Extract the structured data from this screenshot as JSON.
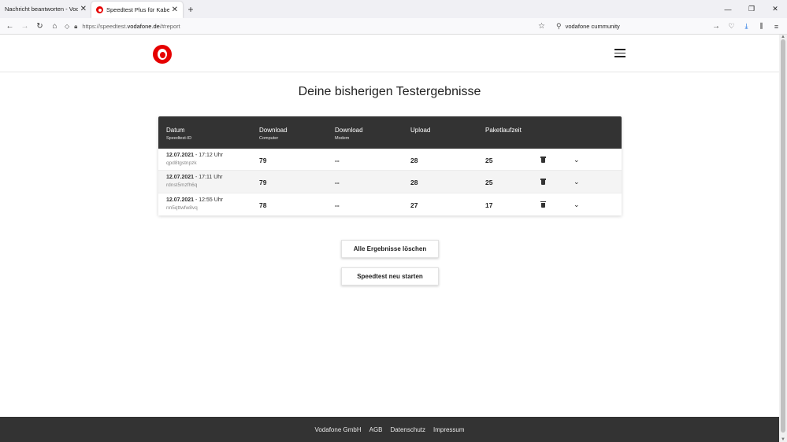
{
  "browser": {
    "tabs": [
      {
        "title": "Nachricht beantworten - Vodafone"
      },
      {
        "title": "Speedtest Plus für Kabel- und D"
      }
    ],
    "new_tab": "+",
    "url_prefix": "https://speedtest.",
    "url_host": "vodafone.de",
    "url_path": "/#report",
    "search_value": "vodafone cummunity"
  },
  "header": {
    "logo_alt": "Vodafone logo"
  },
  "main": {
    "title": "Deine bisherigen Testergebnisse",
    "columns": [
      {
        "label": "Datum",
        "sub": "Speedtest-ID"
      },
      {
        "label": "Download",
        "sub": "Computer"
      },
      {
        "label": "Download",
        "sub": "Modem"
      },
      {
        "label": "Upload",
        "sub": ""
      },
      {
        "label": "Paketlaufzeit",
        "sub": ""
      }
    ],
    "rows": [
      {
        "date": "12.07.2021",
        "time": " - 17:12 Uhr",
        "id": "qpd8tgstnpzk",
        "download_computer": "79",
        "download_modem": "--",
        "upload": "28",
        "latency": "25"
      },
      {
        "date": "12.07.2021",
        "time": " - 17:11 Uhr",
        "id": "rdnst5mzfh6q",
        "download_computer": "79",
        "download_modem": "--",
        "upload": "28",
        "latency": "25"
      },
      {
        "date": "12.07.2021",
        "time": " - 12:55 Uhr",
        "id": "nn5qttwfw8vq",
        "download_computer": "78",
        "download_modem": "--",
        "upload": "27",
        "latency": "17"
      }
    ],
    "delete_all_label": "Alle Ergebnisse löschen",
    "restart_label": "Speedtest neu starten"
  },
  "footer": {
    "links": [
      "Vodafone GmbH",
      "AGB",
      "Datenschutz",
      "Impressum"
    ]
  }
}
